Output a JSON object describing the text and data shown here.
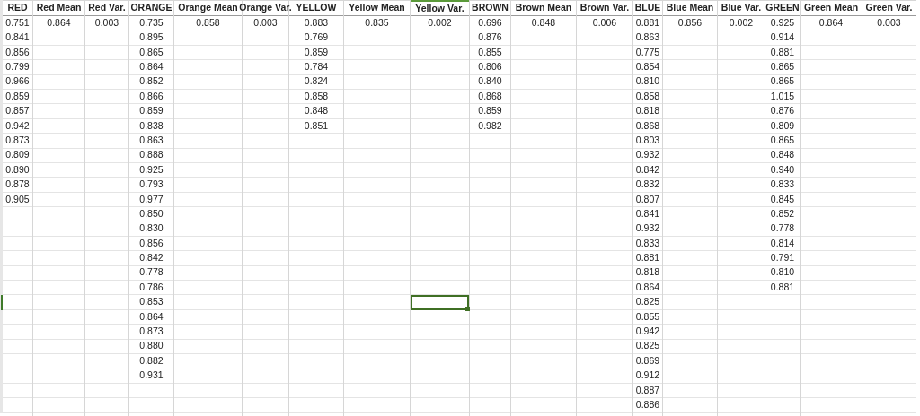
{
  "columns": [
    {
      "header": "RED",
      "cells": [
        {
          "text": "0.751",
          "selected": false
        },
        {
          "text": "0.841",
          "selected": false
        },
        {
          "text": "0.856",
          "selected": false
        },
        {
          "text": "0.799",
          "selected": false
        },
        {
          "text": "0.966",
          "selected": false
        },
        {
          "text": "0.859",
          "selected": false
        },
        {
          "text": "0.857",
          "selected": false
        },
        {
          "text": "0.942",
          "selected": false
        },
        {
          "text": "0.873",
          "selected": false
        },
        {
          "text": "0.809",
          "selected": false
        },
        {
          "text": "0.890",
          "selected": false
        },
        {
          "text": "0.878",
          "selected": false
        },
        {
          "text": "0.905",
          "selected": false
        }
      ]
    },
    {
      "header": "Red Mean",
      "cells": [
        {
          "text": "0.864",
          "selected": false
        }
      ]
    },
    {
      "header": "Red Var.",
      "cells": [
        {
          "text": "0.003",
          "selected": false
        }
      ]
    },
    {
      "header": "ORANGE",
      "cells": [
        {
          "text": "0.735",
          "selected": false
        },
        {
          "text": "0.895",
          "selected": false
        },
        {
          "text": "0.865",
          "selected": false
        },
        {
          "text": "0.864",
          "selected": false
        },
        {
          "text": "0.852",
          "selected": false
        },
        {
          "text": "0.866",
          "selected": false
        },
        {
          "text": "0.859",
          "selected": false
        },
        {
          "text": "0.838",
          "selected": false
        },
        {
          "text": "0.863",
          "selected": false
        },
        {
          "text": "0.888",
          "selected": false
        },
        {
          "text": "0.925",
          "selected": false
        },
        {
          "text": "0.793",
          "selected": false
        },
        {
          "text": "0.977",
          "selected": false
        },
        {
          "text": "0.850",
          "selected": false
        },
        {
          "text": "0.830",
          "selected": false
        },
        {
          "text": "0.856",
          "selected": false
        },
        {
          "text": "0.842",
          "selected": false
        },
        {
          "text": "0.778",
          "selected": false
        },
        {
          "text": "0.786",
          "selected": false
        },
        {
          "text": "0.853",
          "selected": false
        },
        {
          "text": "0.864",
          "selected": false
        },
        {
          "text": "0.873",
          "selected": false
        },
        {
          "text": "0.880",
          "selected": false
        },
        {
          "text": "0.882",
          "selected": false
        },
        {
          "text": "0.931",
          "selected": false
        }
      ]
    },
    {
      "header": "Orange Mean",
      "cells": [
        {
          "text": "0.858",
          "selected": false
        }
      ]
    },
    {
      "header": "Orange Var.",
      "cells": [
        {
          "text": "0.003",
          "selected": false
        }
      ]
    },
    {
      "header": "YELLOW",
      "cells": [
        {
          "text": "0.883",
          "selected": false
        },
        {
          "text": "0.769",
          "selected": false
        },
        {
          "text": "0.859",
          "selected": false
        },
        {
          "text": "0.784",
          "selected": false
        },
        {
          "text": "0.824",
          "selected": false
        },
        {
          "text": "0.858",
          "selected": false
        },
        {
          "text": "0.848",
          "selected": false
        },
        {
          "text": "0.851",
          "selected": false
        }
      ]
    },
    {
      "header": "Yellow Mean",
      "cells": [
        {
          "text": "0.835",
          "selected": false
        }
      ]
    },
    {
      "header": "Yellow Var.",
      "cells": [
        {
          "text": "0.002",
          "selected": false
        },
        {
          "selected": false
        },
        {
          "selected": false
        },
        {
          "selected": false
        },
        {
          "selected": false
        },
        {
          "selected": false
        },
        {
          "selected": false
        },
        {
          "selected": false
        },
        {
          "selected": false
        },
        {
          "selected": false
        },
        {
          "selected": false
        },
        {
          "selected": false
        },
        {
          "selected": false
        },
        {
          "selected": false
        },
        {
          "selected": false
        },
        {
          "selected": false
        },
        {
          "selected": false
        },
        {
          "selected": false
        },
        {
          "selected": false
        },
        {
          "selected": true
        }
      ]
    },
    {
      "header": "BROWN",
      "cells": [
        {
          "text": "0.696",
          "selected": false
        },
        {
          "text": "0.876",
          "selected": false
        },
        {
          "text": "0.855",
          "selected": false
        },
        {
          "text": "0.806",
          "selected": false
        },
        {
          "text": "0.840",
          "selected": false
        },
        {
          "text": "0.868",
          "selected": false
        },
        {
          "text": "0.859",
          "selected": false
        },
        {
          "text": "0.982",
          "selected": false
        }
      ]
    },
    {
      "header": "Brown Mean",
      "cells": [
        {
          "text": "0.848",
          "selected": false
        }
      ]
    },
    {
      "header": "Brown Var.",
      "cells": [
        {
          "text": "0.006",
          "selected": false
        }
      ]
    },
    {
      "header": "BLUE",
      "cells": [
        {
          "text": "0.881",
          "selected": false
        },
        {
          "text": "0.863",
          "selected": false
        },
        {
          "text": "0.775",
          "selected": false
        },
        {
          "text": "0.854",
          "selected": false
        },
        {
          "text": "0.810",
          "selected": false
        },
        {
          "text": "0.858",
          "selected": false
        },
        {
          "text": "0.818",
          "selected": false
        },
        {
          "text": "0.868",
          "selected": false
        },
        {
          "text": "0.803",
          "selected": false
        },
        {
          "text": "0.932",
          "selected": false
        },
        {
          "text": "0.842",
          "selected": false
        },
        {
          "text": "0.832",
          "selected": false
        },
        {
          "text": "0.807",
          "selected": false
        },
        {
          "text": "0.841",
          "selected": false
        },
        {
          "text": "0.932",
          "selected": false
        },
        {
          "text": "0.833",
          "selected": false
        },
        {
          "text": "0.881",
          "selected": false
        },
        {
          "text": "0.818",
          "selected": false
        },
        {
          "text": "0.864",
          "selected": false
        },
        {
          "text": "0.825",
          "selected": false
        },
        {
          "text": "0.855",
          "selected": false
        },
        {
          "text": "0.942",
          "selected": false
        },
        {
          "text": "0.825",
          "selected": false
        },
        {
          "text": "0.869",
          "selected": false
        },
        {
          "text": "0.912",
          "selected": false
        },
        {
          "text": "0.887",
          "selected": false
        },
        {
          "text": "0.886",
          "selected": false
        }
      ]
    },
    {
      "header": "Blue Mean",
      "cells": [
        {
          "text": "0.856",
          "selected": false
        }
      ]
    },
    {
      "header": "Blue Var.",
      "cells": [
        {
          "text": "0.002",
          "selected": false
        }
      ]
    },
    {
      "header": "GREEN",
      "cells": [
        {
          "text": "0.925",
          "selected": false
        },
        {
          "text": "0.914",
          "selected": false
        },
        {
          "text": "0.881",
          "selected": false
        },
        {
          "text": "0.865",
          "selected": false
        },
        {
          "text": "0.865",
          "selected": false
        },
        {
          "text": "1.015",
          "selected": false
        },
        {
          "text": "0.876",
          "selected": false
        },
        {
          "text": "0.809",
          "selected": false
        },
        {
          "text": "0.865",
          "selected": false
        },
        {
          "text": "0.848",
          "selected": false
        },
        {
          "text": "0.940",
          "selected": false
        },
        {
          "text": "0.833",
          "selected": false
        },
        {
          "text": "0.845",
          "selected": false
        },
        {
          "text": "0.852",
          "selected": false
        },
        {
          "text": "0.778",
          "selected": false
        },
        {
          "text": "0.814",
          "selected": false
        },
        {
          "text": "0.791",
          "selected": false
        },
        {
          "text": "0.810",
          "selected": false
        },
        {
          "text": "0.881",
          "selected": false
        }
      ]
    },
    {
      "header": "Green Mean",
      "cells": [
        {
          "text": "0.864",
          "selected": false
        }
      ]
    },
    {
      "header": "Green Var.",
      "cells": [
        {
          "text": "0.003",
          "selected": false
        }
      ]
    }
  ]
}
